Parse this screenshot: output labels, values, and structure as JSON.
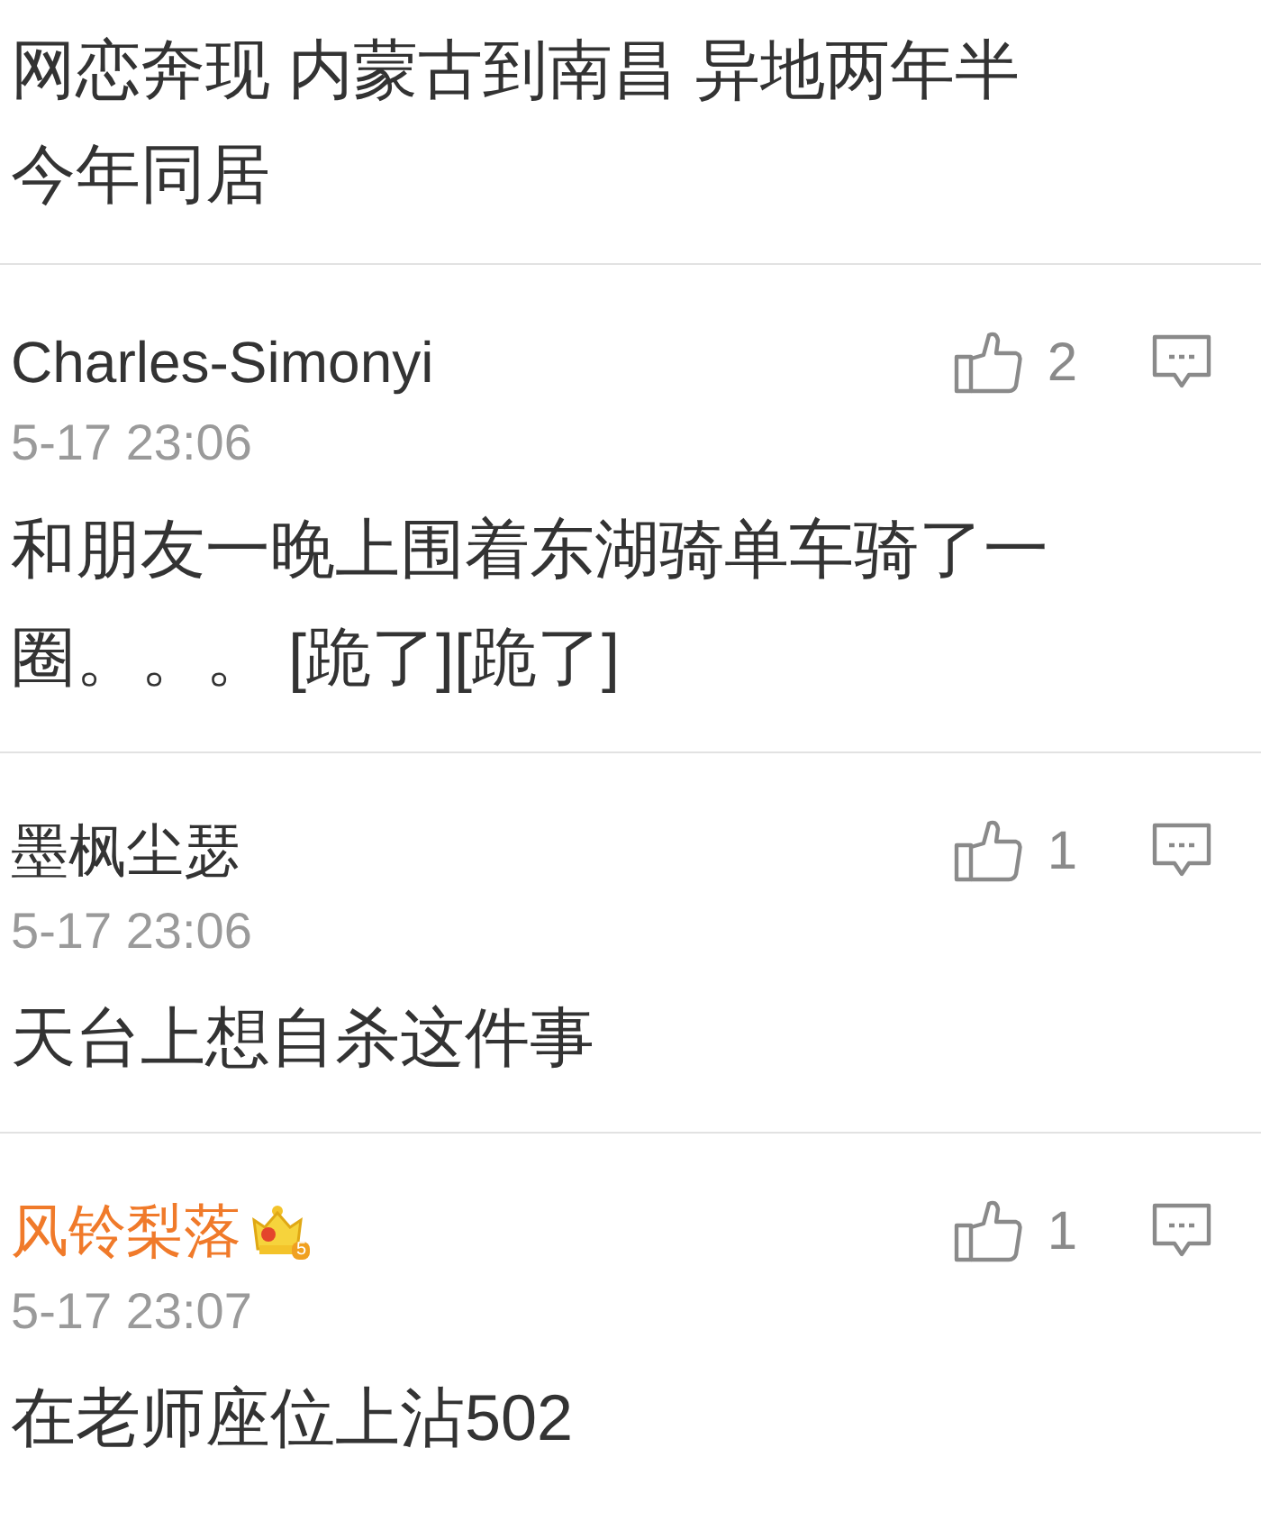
{
  "post": {
    "lines": [
      "网恋奔现 内蒙古到南昌 异地两年半",
      "今年同居"
    ]
  },
  "comments": [
    {
      "author": "Charles-Simonyi",
      "vip": false,
      "time": "5-17 23:06",
      "likes": "2",
      "text": "和朋友一晚上围着东湖骑单车骑了一圈。。。 [跪了][跪了]"
    },
    {
      "author": "墨枫尘瑟",
      "vip": false,
      "time": "5-17 23:06",
      "likes": "1",
      "text": "天台上想自杀这件事"
    },
    {
      "author": "风铃梨落",
      "vip": true,
      "vip_level": "5",
      "time": "5-17 23:07",
      "likes": "1",
      "text": "在老师座位上沾502"
    }
  ]
}
